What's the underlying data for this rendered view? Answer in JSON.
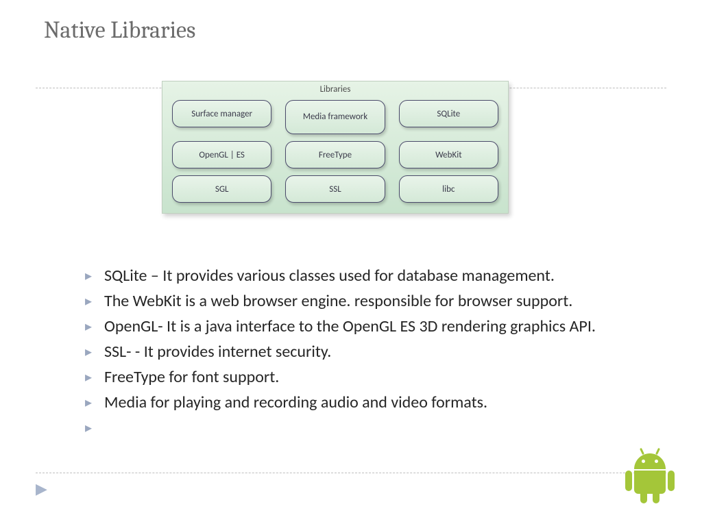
{
  "title": "Native Libraries",
  "diagram": {
    "header": "Libraries",
    "cells": [
      [
        "Surface manager",
        "Media\nframework",
        "SQLite"
      ],
      [
        "OpenGL  |  ES",
        "FreeType",
        "WebKit"
      ],
      [
        "SGL",
        "SSL",
        "libc"
      ]
    ]
  },
  "bullets": [
    "SQLite – It provides various classes used for database management.",
    "The WebKit is a web browser engine. responsible for browser support.",
    "OpenGL- It is a java  interface to the OpenGL ES 3D rendering graphics API.",
    "SSL- - It provides internet security.",
    " FreeType for font support.",
    " Media for playing and recording audio and video formats.",
    ""
  ]
}
